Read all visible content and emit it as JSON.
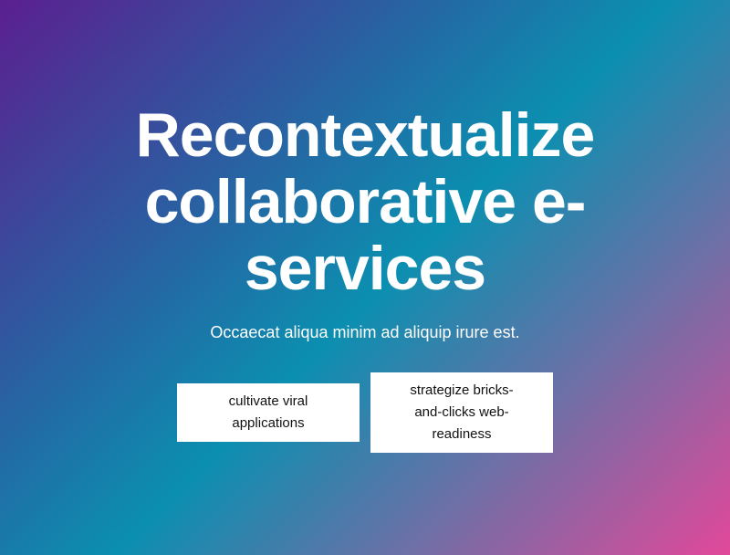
{
  "hero": {
    "title_lines": [
      "Recontextualize",
      "collaborative e-",
      "services"
    ],
    "subtitle": "Occaecat aliqua minim ad aliquip irure est.",
    "buttons": [
      {
        "label_lines": [
          "cultivate viral",
          "applications"
        ]
      },
      {
        "label_lines": [
          "strategize bricks-",
          "and-clicks web-",
          "readiness"
        ]
      }
    ]
  },
  "colors": {
    "gradient": [
      "#5b1f8f",
      "#2e5aa0",
      "#0b8fb0",
      "#6f6fa6",
      "#e2489a"
    ],
    "button_bg": "#ffffff",
    "text": "#ffffff"
  }
}
